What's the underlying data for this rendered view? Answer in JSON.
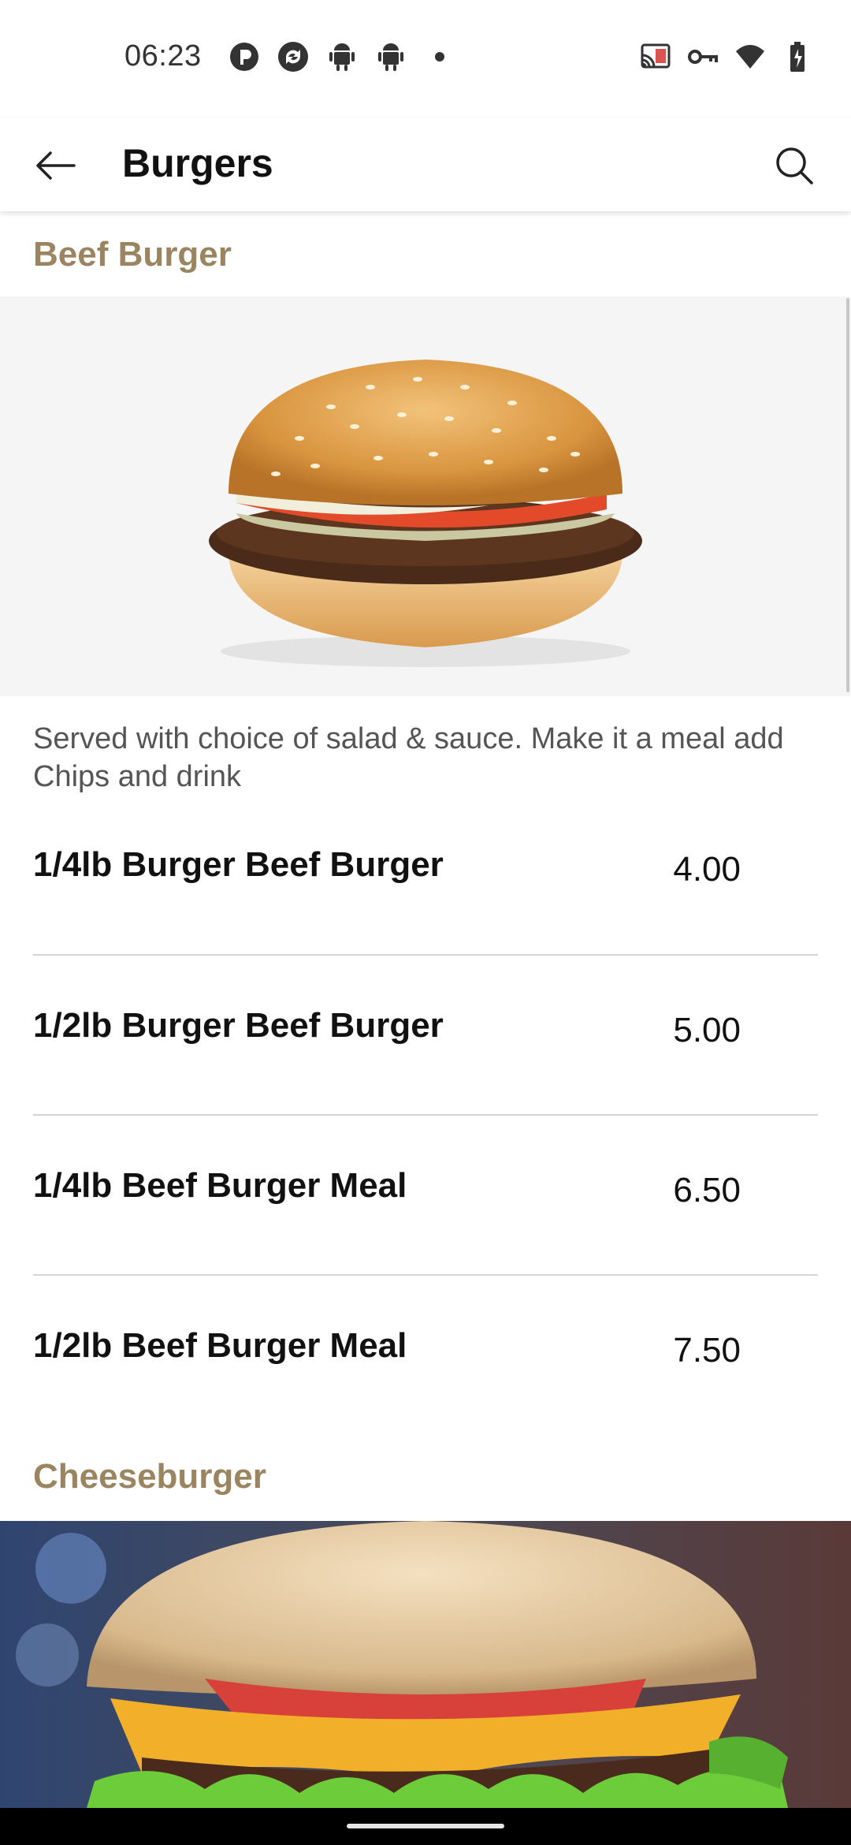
{
  "status": {
    "time": "06:23",
    "left_icons": [
      "p-badge-icon",
      "sync-icon",
      "android-icon",
      "android-icon",
      "dot-icon"
    ],
    "right_icons": [
      "cast-icon",
      "key-icon",
      "wifi-icon",
      "battery-charging-icon"
    ]
  },
  "appbar": {
    "title": "Burgers",
    "back_icon": "arrow-back-icon",
    "search_icon": "search-icon"
  },
  "sections": [
    {
      "title": "Beef Burger",
      "description": "Served with choice of salad & sauce. Make it a meal add Chips and drink",
      "items": [
        {
          "name": "1/4lb Burger Beef Burger",
          "price": "4.00"
        },
        {
          "name": "1/2lb Burger Beef Burger",
          "price": "5.00"
        },
        {
          "name": "1/4lb Beef Burger Meal",
          "price": "6.50"
        },
        {
          "name": "1/2lb Beef Burger Meal",
          "price": "7.50"
        }
      ]
    },
    {
      "title": "Cheeseburger"
    }
  ],
  "colors": {
    "accent": "#9a8560",
    "divider": "#d4d4d4"
  }
}
